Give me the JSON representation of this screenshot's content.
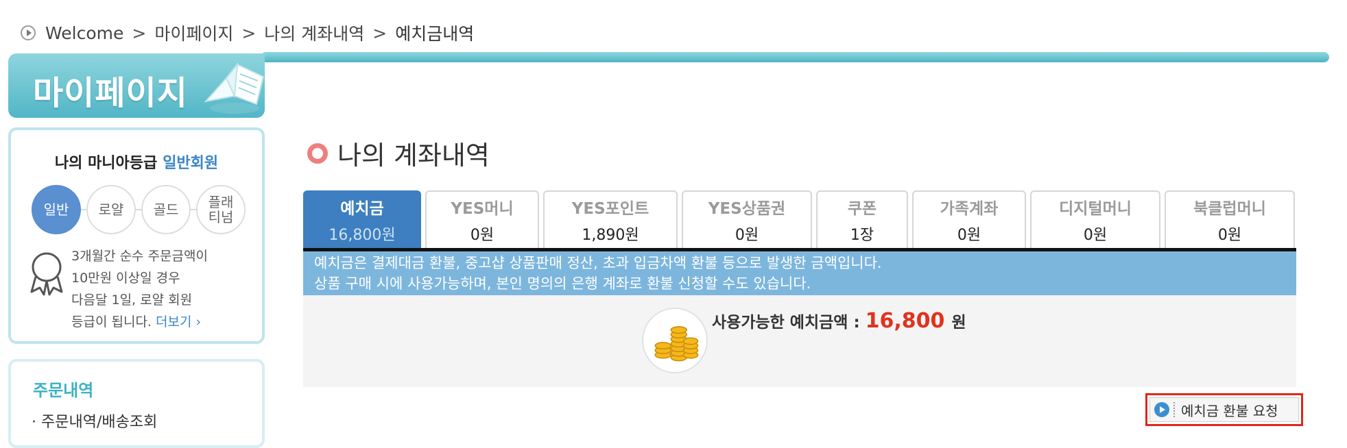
{
  "breadcrumb": {
    "items": [
      "Welcome",
      "마이페이지",
      "나의 계좌내역",
      "예치금내역"
    ],
    "separator": ">"
  },
  "sidebar": {
    "header_title": "마이페이지",
    "grade": {
      "title": "나의 마니아등급",
      "current_level": "일반회원",
      "levels": [
        "일반",
        "로얄",
        "골드",
        "플래\n티넘"
      ],
      "active_level": 0,
      "description_lines": [
        "3개월간 순수 주문금액이",
        "10만원 이상일 경우",
        "다음달 1일, 로얄 회원",
        "등급이 됩니다."
      ],
      "more_link": "더보기 ›"
    },
    "orders": {
      "title": "주문내역",
      "items": [
        "· 주문내역/배송조회"
      ]
    }
  },
  "main": {
    "title": "나의 계좌내역",
    "tabs": [
      {
        "label": "예치금",
        "value": "16,800원",
        "active": true
      },
      {
        "label": "YES머니",
        "value": "0원"
      },
      {
        "label": "YES포인트",
        "value": "1,890원"
      },
      {
        "label": "YES상품권",
        "value": "0원"
      },
      {
        "label": "쿠폰",
        "value": "1장"
      },
      {
        "label": "가족계좌",
        "value": "0원"
      },
      {
        "label": "디지털머니",
        "value": "0원"
      },
      {
        "label": "북클럽머니",
        "value": "0원"
      }
    ],
    "info_lines": [
      "예치금은 결제대금 환불, 중고샵 상품판매 정산, 초과 입금차액 환불 등으로 발생한 금액입니다.",
      "상품 구매 시에 사용가능하며, 본인 명의의 은행 계좌로 환불 신청할 수도 있습니다."
    ],
    "balance": {
      "label": "사용가능한 예치금액 :",
      "amount": "16,800",
      "unit": "원"
    },
    "refund_button": "예치금 환불 요청"
  },
  "colors": {
    "accent_teal": "#52b6c6",
    "tab_active": "#3d7fc0",
    "info_banner": "#7db6dd",
    "amount_red": "#e0321e",
    "highlight_border": "#e0261c"
  },
  "icons": [
    "breadcrumb-arrow-icon",
    "book-icon",
    "ribbon-icon",
    "title-ring-icon",
    "coin-stack-icon",
    "play-circle-icon"
  ]
}
